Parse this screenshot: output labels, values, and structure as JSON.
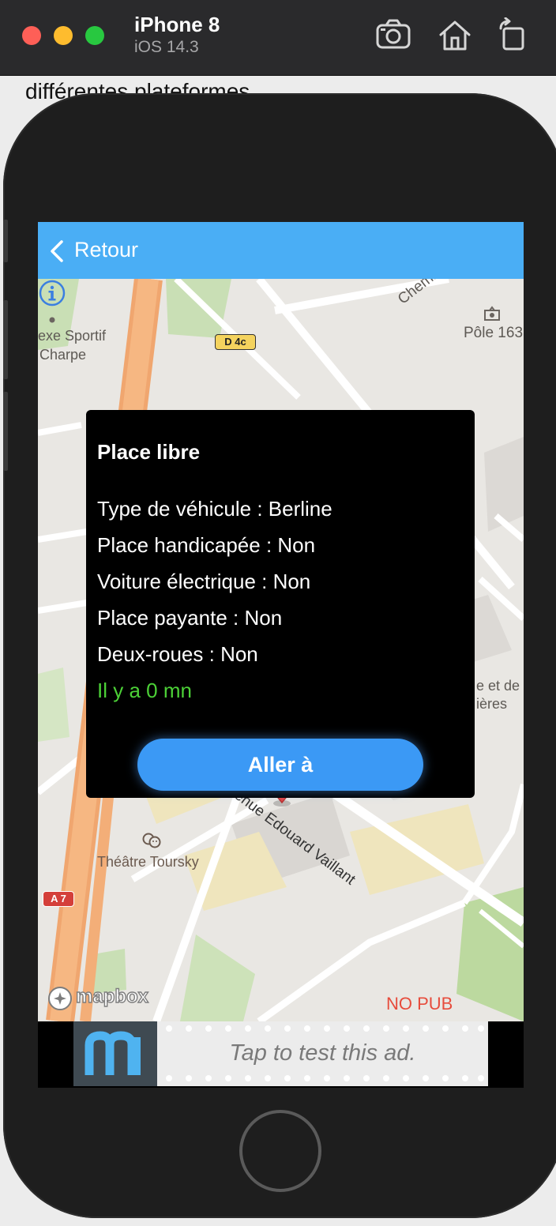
{
  "simulator": {
    "device_name": "iPhone 8",
    "os_version": "iOS 14.3",
    "toolbar_icons": [
      "screenshot-icon",
      "home-icon",
      "rotate-icon"
    ]
  },
  "background_text": "différentes plateformes",
  "nav": {
    "back_label": "Retour"
  },
  "map": {
    "road_badges": [
      "D 4c",
      "A 7"
    ],
    "places": {
      "sport_line1": "exe Sportif",
      "sport_line2": "Charpe",
      "chemin": "Chemi",
      "pole": "Pôle 163",
      "right_line1": "e et de",
      "right_line2": "ières",
      "theatre": "Théâtre Toursky",
      "avenue": "Avenue Edouard Vaillant"
    },
    "attribution": "mapbox",
    "no_pub": "NO PUB",
    "accent_color": "#4aaef5"
  },
  "popup": {
    "title": "Place libre",
    "lines": [
      "Type de véhicule : Berline",
      "Place handicapée : Non",
      "Voiture électrique : Non",
      "Place payante : Non",
      "Deux-roues : Non"
    ],
    "time": "Il y a 0 mn",
    "time_color": "#4cd137",
    "button_label": "Aller à",
    "button_color": "#3b99f5"
  },
  "ad": {
    "text": "Tap to test this ad."
  }
}
